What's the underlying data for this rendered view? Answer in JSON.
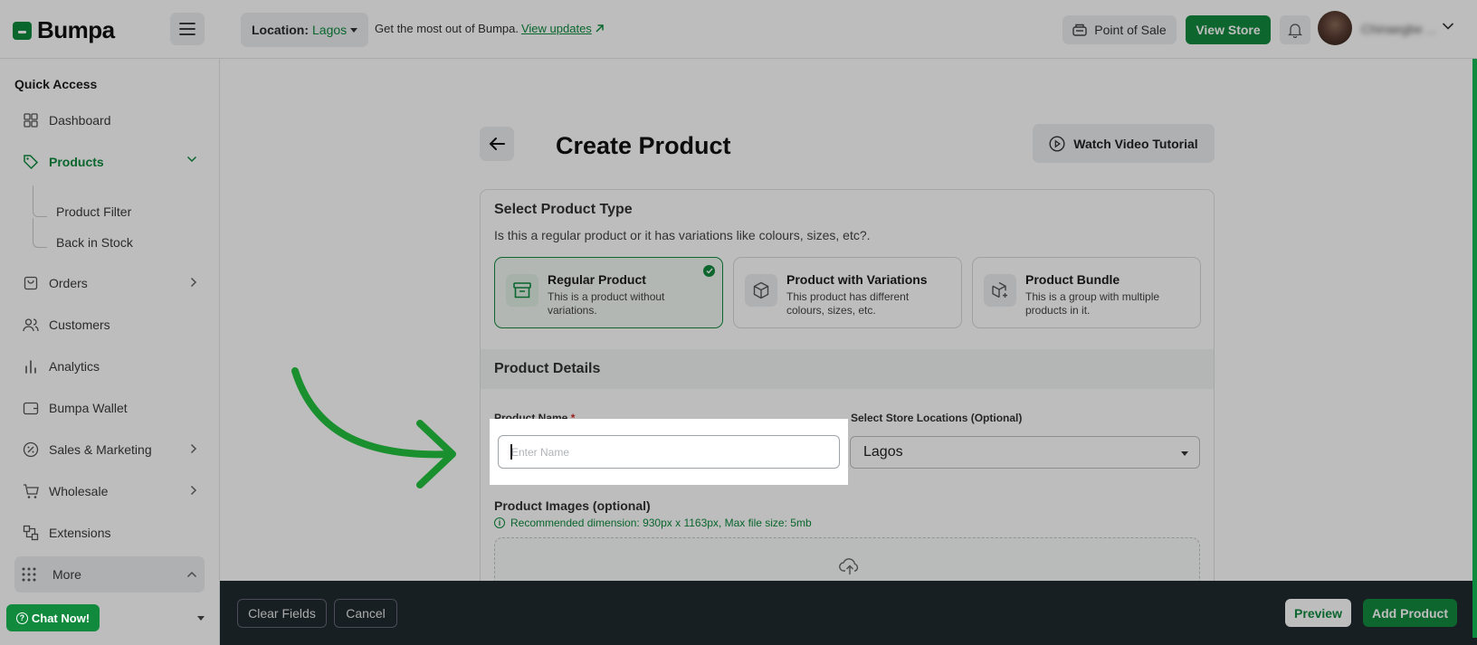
{
  "app": {
    "logo": "Bumpa",
    "brand_color": "#118a3e"
  },
  "topbar": {
    "location_label": "Location:",
    "location_value": "Lagos",
    "notice_text": "Get the most out of Bumpa.",
    "notice_link": "View updates",
    "pos_label": "Point of Sale",
    "view_store_label": "View Store",
    "user_name": "Chinaegbe ..."
  },
  "sidebar": {
    "section_title": "Quick Access",
    "items": [
      {
        "label": "Dashboard",
        "icon": "grid-icon"
      },
      {
        "label": "Products",
        "icon": "tag-icon",
        "active": true
      },
      {
        "label": "Orders",
        "icon": "bag-icon"
      },
      {
        "label": "Customers",
        "icon": "users-icon"
      },
      {
        "label": "Analytics",
        "icon": "bar-chart-icon"
      },
      {
        "label": "Bumpa Wallet",
        "icon": "wallet-icon"
      },
      {
        "label": "Sales & Marketing",
        "icon": "percent-icon"
      },
      {
        "label": "Wholesale",
        "icon": "cart-icon"
      },
      {
        "label": "Extensions",
        "icon": "extension-icon"
      }
    ],
    "sub_items": [
      "Product Filter",
      "Back in Stock"
    ],
    "more_label": "More",
    "chat_label": "Chat Now!"
  },
  "main": {
    "page_title": "Create Product",
    "watch_label": "Watch Video Tutorial",
    "type_section": {
      "title": "Select Product Type",
      "description": "Is this a regular product or it has variations like colours, sizes, etc?.",
      "options": [
        {
          "title": "Regular Product",
          "desc": "This is a product without variations.",
          "selected": true
        },
        {
          "title": "Product with Variations",
          "desc": "This product has different colours, sizes, etc."
        },
        {
          "title": "Product Bundle",
          "desc": "This is a group with multiple products in it."
        }
      ]
    },
    "details": {
      "title": "Product Details",
      "name_label": "Product Name",
      "name_required": "*",
      "name_placeholder": "Enter Name",
      "location_label": "Select Store Locations (Optional)",
      "location_value": "Lagos",
      "images_label": "Product Images (optional)",
      "images_hint": "Recommended dimension: 930px x 1163px, Max file size: 5mb"
    }
  },
  "bottombar": {
    "clear_label": "Clear Fields",
    "cancel_label": "Cancel",
    "preview_label": "Preview",
    "add_label": "Add Product"
  }
}
